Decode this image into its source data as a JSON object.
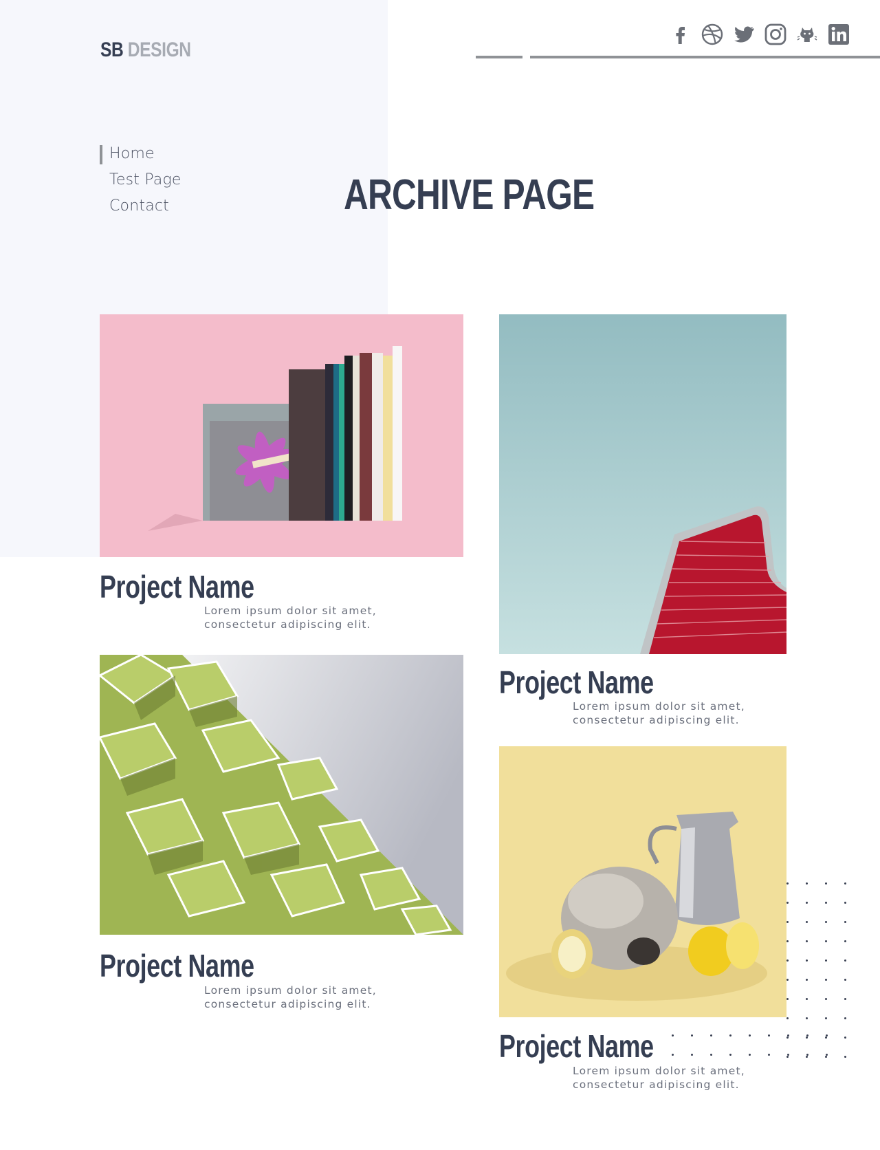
{
  "brand": {
    "sb": "SB",
    "design": "DESIGN"
  },
  "social": [
    {
      "icon": "facebook-icon"
    },
    {
      "icon": "dribbble-icon"
    },
    {
      "icon": "twitter-icon"
    },
    {
      "icon": "instagram-icon"
    },
    {
      "icon": "github-icon"
    },
    {
      "icon": "linkedin-icon"
    }
  ],
  "nav": {
    "items": [
      {
        "label": "Home",
        "active": true
      },
      {
        "label": "Test Page",
        "active": false
      },
      {
        "label": "Contact",
        "active": false
      }
    ]
  },
  "page": {
    "title": "ARCHIVE PAGE"
  },
  "projects": [
    {
      "name": "Project Name",
      "desc": "Lorem ipsum dolor sit amet, consectetur adipiscing elit.",
      "image": "books-photo"
    },
    {
      "name": "Project Name",
      "desc": "Lorem ipsum dolor sit amet, consectetur adipiscing elit.",
      "image": "red-building-photo"
    },
    {
      "name": "Project Name",
      "desc": "Lorem ipsum dolor sit amet, consectetur adipiscing elit.",
      "image": "green-balconies-photo"
    },
    {
      "name": "Project Name",
      "desc": "Lorem ipsum dolor sit amet, consectetur adipiscing elit.",
      "image": "skull-lemons-photo"
    }
  ],
  "colors": {
    "navy": "#353e52",
    "panel": "#f6f7fc",
    "rule": "#8f9296",
    "pink": "#f4bccb",
    "sky": "#9ec5c8",
    "lime": "#b8c96a",
    "yellow": "#f1df9b"
  }
}
